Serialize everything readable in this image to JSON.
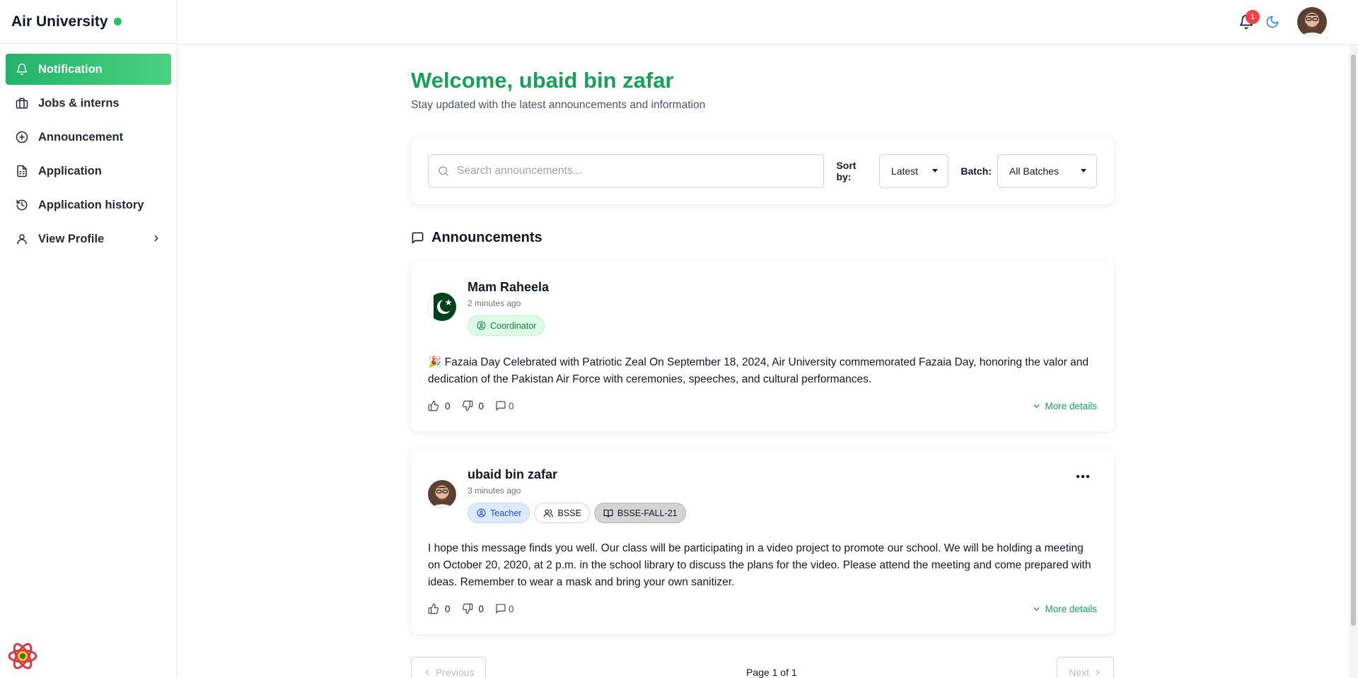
{
  "brand": {
    "title": "Air University",
    "status_color": "#22c55e"
  },
  "sidebar": {
    "items": [
      {
        "label": "Notification",
        "icon": "bell-icon",
        "active": true
      },
      {
        "label": "Jobs & interns",
        "icon": "briefcase-icon"
      },
      {
        "label": "Announcement",
        "icon": "plus-circle-icon"
      },
      {
        "label": "Application",
        "icon": "document-icon"
      },
      {
        "label": "Application history",
        "icon": "history-icon"
      },
      {
        "label": "View Profile",
        "icon": "user-icon"
      }
    ]
  },
  "topbar": {
    "notification_count": "1"
  },
  "main": {
    "welcome": "Welcome, ubaid bin zafar",
    "subtitle": "Stay updated with the latest announcements and information"
  },
  "filters": {
    "search_placeholder": "Search announcements...",
    "sort_label": "Sort by:",
    "sort_value": "Latest",
    "batch_label": "Batch:",
    "batch_value": "All Batches"
  },
  "announcements": {
    "heading": "Announcements",
    "posts": [
      {
        "author": "Mam Raheela",
        "time": "2 minutes ago",
        "badges": [
          "Coordinator"
        ],
        "text": "🎉 Fazaia Day Celebrated with Patriotic Zeal On September 18, 2024, Air University commemorated Fazaia Day, honoring the valor and dedication of the Pakistan Air Force with ceremonies, speeches, and cultural performances.",
        "likes": "0",
        "dislikes": "0",
        "comments": "0",
        "more": "More details"
      },
      {
        "author": "ubaid bin zafar",
        "time": "3 minutes ago",
        "badges": [
          "Teacher",
          "BSSE",
          "BSSE-FALL-21"
        ],
        "text": "I hope this message finds you well. Our class will be participating in a video project to promote our school. We will be holding a meeting on October 20, 2020, at 2 p.m. in the school library to discuss the plans for the video. Please attend the meeting and come prepared with ideas. Remember to wear a mask and bring your own sanitizer.",
        "likes": "0",
        "dislikes": "0",
        "comments": "0",
        "more": "More details"
      }
    ]
  },
  "pagination": {
    "previous": "Previous",
    "page_label": "Page 1 of 1",
    "next": "Next"
  },
  "colors": {
    "accent": "#16a05a",
    "sidebar_active_start": "#22b36a",
    "sidebar_active_end": "#4cd180",
    "badge_red": "#ef4444"
  }
}
